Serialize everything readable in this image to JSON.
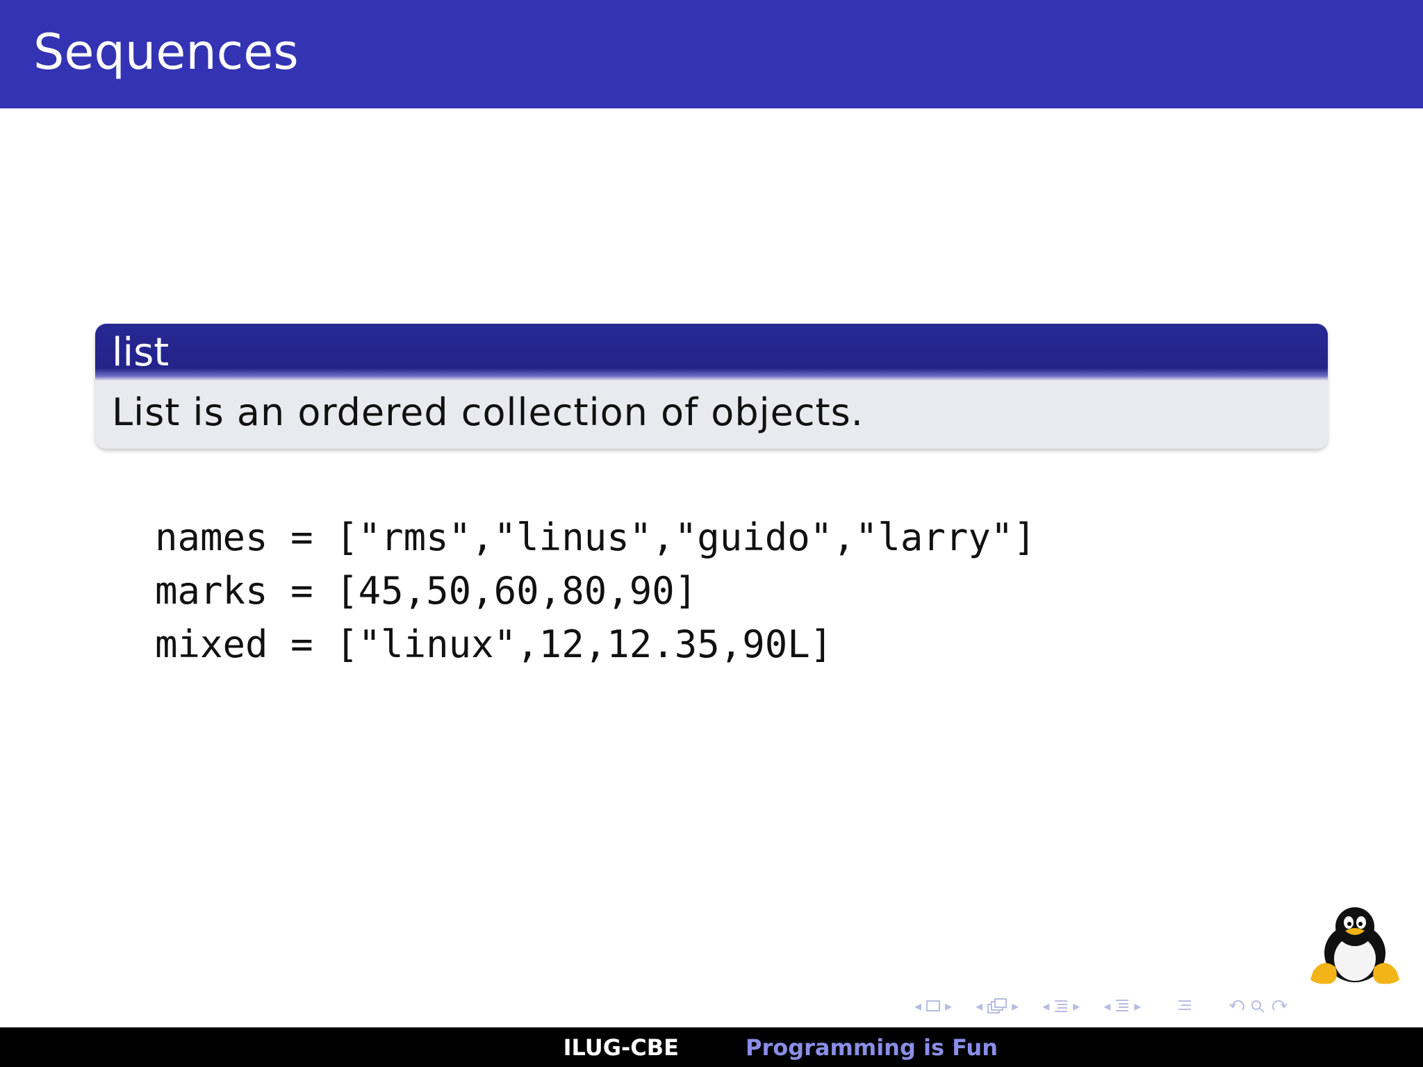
{
  "frame": {
    "title": "Sequences"
  },
  "block": {
    "title": "list",
    "body": "List is an ordered collection of objects."
  },
  "code": {
    "lines": [
      "names = [\"rms\",\"linus\",\"guido\",\"larry\"]",
      "marks = [45,50,60,80,90]",
      "mixed = [\"linux\",12,12.35,90L]"
    ]
  },
  "footer": {
    "left": "ILUG-CBE",
    "right": "Programming is Fun"
  },
  "icons": {
    "logo": "tux-penguin-icon",
    "nav": [
      "frame-nav-icon",
      "subsection-nav-icon",
      "section-nav-icon",
      "document-nav-icon",
      "toc-icon",
      "back-icon",
      "search-icon",
      "forward-icon"
    ]
  },
  "colors": {
    "header_bar": "#3333b3",
    "block_title": "#232388",
    "block_body": "#e9e9f0",
    "footer": "#000000",
    "footer_right_text": "#8a8ee6"
  }
}
